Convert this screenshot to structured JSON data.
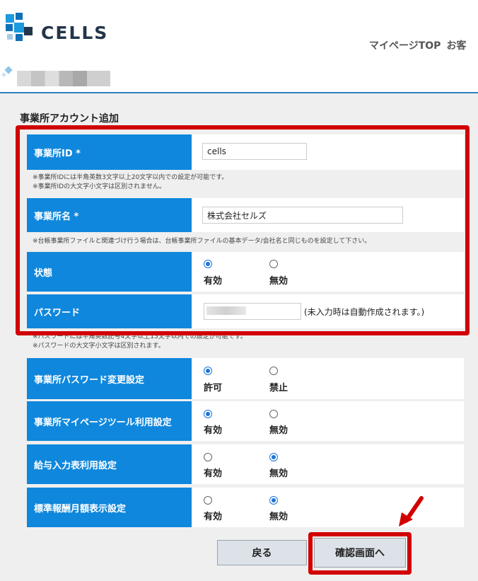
{
  "header": {
    "logo_text": "CELLS",
    "nav": [
      "マイページTOP",
      "お客"
    ]
  },
  "section_title": "事業所アカウント追加",
  "fields": {
    "office_id": {
      "label": "事業所ID *",
      "value": "cells",
      "notes": [
        "※事業所IDには半角英数3文字以上20文字以内での設定が可能です。",
        "※事業所IDの大文字小文字は区別されません。"
      ]
    },
    "office_name": {
      "label": "事業所名 *",
      "value": "株式会社セルズ",
      "notes": [
        "※台帳事業所ファイルと関連づけ行う場合は、台帳事業所ファイルの基本データ/会社名と同じものを設定して下さい。"
      ]
    },
    "status": {
      "label": "状態",
      "options": [
        "有効",
        "無効"
      ],
      "selected": 0
    },
    "password": {
      "label": "パスワード",
      "value": "",
      "hint": "(未入力時は自動作成されます。)",
      "notes": [
        "※パスワードには半角英数記号4文字以上15文字以内での設定が可能です。",
        "※パスワードの大文字小文字は区別されます。"
      ]
    },
    "password_change": {
      "label": "事業所パスワード変更設定",
      "options": [
        "許可",
        "禁止"
      ],
      "selected": 0
    },
    "mypage_tool": {
      "label": "事業所マイページツール利用設定",
      "options": [
        "有効",
        "無効"
      ],
      "selected": 0
    },
    "salary_input": {
      "label": "給与入力表利用設定",
      "options": [
        "有効",
        "無効"
      ],
      "selected": 1
    },
    "standard_pay": {
      "label": "標準報酬月額表示設定",
      "options": [
        "有効",
        "無効"
      ],
      "selected": 1
    }
  },
  "buttons": {
    "back": "戻る",
    "confirm": "確認画面へ"
  },
  "colors": {
    "label_bg": "#0f87dc",
    "highlight": "#d20000",
    "accent_line": "#2d7fb8"
  }
}
